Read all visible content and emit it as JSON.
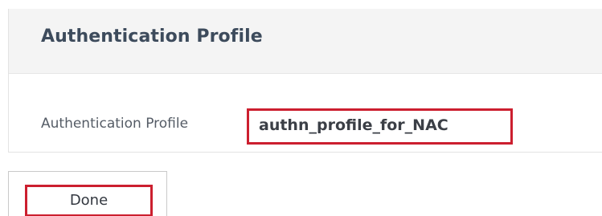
{
  "panel": {
    "title": "Authentication Profile",
    "field": {
      "label": "Authentication Profile",
      "value": "authn_profile_for_NAC"
    }
  },
  "actions": {
    "done_label": "Done"
  },
  "colors": {
    "highlight": "#cc1f2f",
    "header_background": "#f4f4f4",
    "title_text": "#3d4b5c"
  }
}
